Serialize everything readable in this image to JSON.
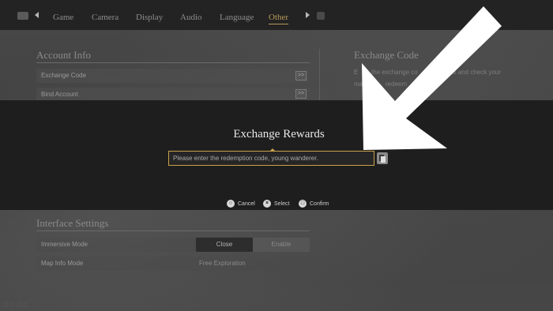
{
  "tabs": {
    "items": [
      {
        "label": "Game"
      },
      {
        "label": "Camera"
      },
      {
        "label": "Display"
      },
      {
        "label": "Audio"
      },
      {
        "label": "Language"
      },
      {
        "label": "Other"
      }
    ],
    "active": "Other"
  },
  "account_info": {
    "title": "Account Info",
    "rows": [
      {
        "label": "Exchange Code",
        "button": ">>"
      },
      {
        "label": "Bind Account",
        "button": ">>"
      }
    ]
  },
  "exchange_code_panel": {
    "title": "Exchange Code",
    "text_line1_a": "E",
    "text_line1_b": "the exchange co",
    "text_line1_c": "ards and check your",
    "text_line2_a": "ma",
    "text_line2_b": "redeem"
  },
  "interface_settings": {
    "title": "Interface Settings",
    "rows": [
      {
        "label": "Immersive Mode",
        "option_a": "Close",
        "option_b": "Enable"
      },
      {
        "label": "Map Info Mode",
        "value": "Free Exploration"
      }
    ]
  },
  "modal": {
    "title": "Exchange Rewards",
    "input_placeholder": "Please enter the redemption code, young wanderer.",
    "input_value": ""
  },
  "hints": [
    {
      "glyph": "○",
      "label": "Cancel"
    },
    {
      "glyph": "×",
      "label": "Select"
    },
    {
      "glyph": "□",
      "label": "Confirm"
    }
  ],
  "colors": {
    "accent": "#c8a24a",
    "modal_bg": "#1e1e1e",
    "topbar_bg": "#232323",
    "annotation_arrow": "#ffffff"
  }
}
